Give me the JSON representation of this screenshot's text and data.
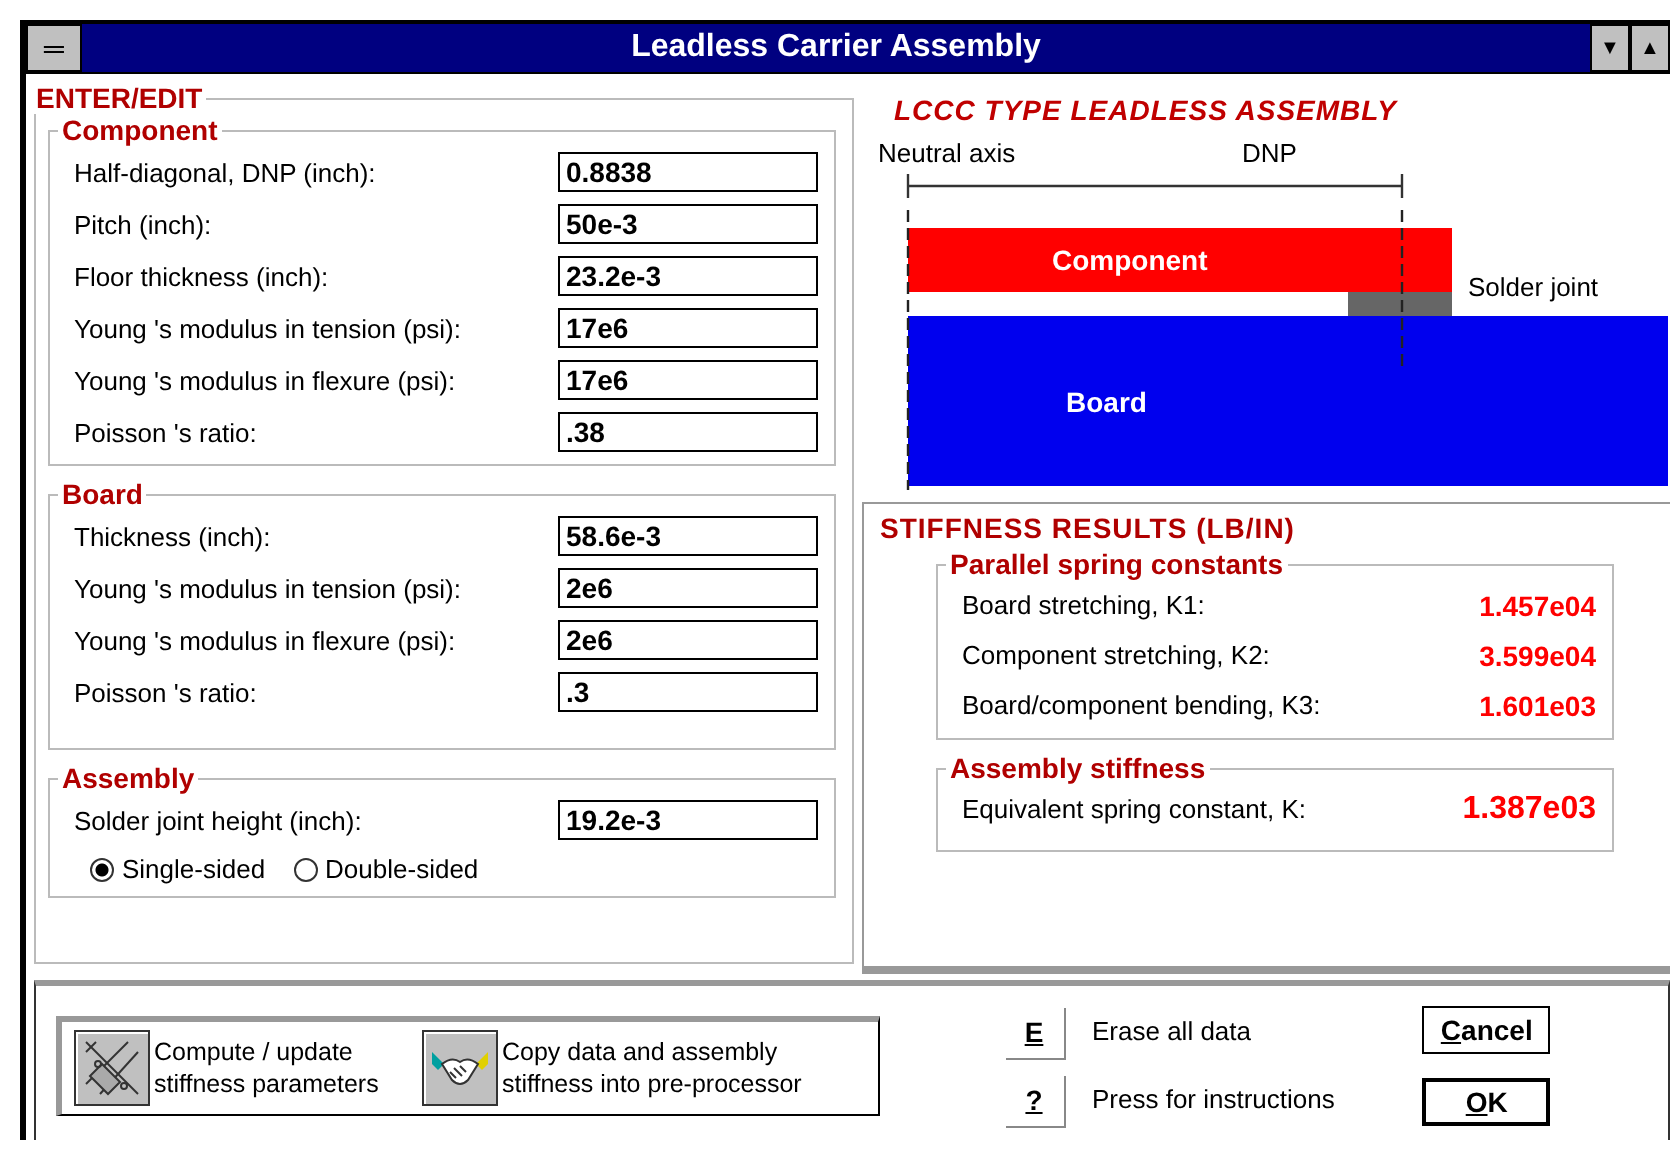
{
  "window": {
    "title": "Leadless Carrier Assembly",
    "system_menu": "═",
    "controls": [
      "▼",
      "▲"
    ]
  },
  "enter_edit": {
    "title": "ENTER/EDIT",
    "groups": [
      {
        "title": "Component",
        "fields": [
          {
            "label": "Half-diagonal, DNP (inch):",
            "value": "0.8838"
          },
          {
            "label": "Pitch (inch):",
            "value": "50e-3"
          },
          {
            "label": "Floor thickness (inch):",
            "value": "23.2e-3"
          },
          {
            "label": "Young 's modulus in tension (psi):",
            "value": "17e6"
          },
          {
            "label": "Young 's modulus in flexure (psi):",
            "value": "17e6"
          },
          {
            "label": "Poisson 's ratio:",
            "value": ".38"
          }
        ]
      },
      {
        "title": "Board",
        "fields": [
          {
            "label": "Thickness (inch):",
            "value": "58.6e-3"
          },
          {
            "label": "Young 's modulus in tension (psi):",
            "value": "2e6"
          },
          {
            "label": "Young 's modulus in flexure (psi):",
            "value": "2e6"
          },
          {
            "label": "Poisson 's ratio:",
            "value": ".3"
          }
        ]
      },
      {
        "title": "Assembly",
        "fields": [
          {
            "label": "Solder joint height (inch):",
            "value": "19.2e-3"
          }
        ],
        "options": [
          {
            "label": "Single-sided",
            "selected": true
          },
          {
            "label": "Double-sided",
            "selected": false
          }
        ]
      }
    ]
  },
  "diagram": {
    "title": "LCCC TYPE LEADLESS ASSEMBLY",
    "neutral_axis": "Neutral axis",
    "dnp": "DNP",
    "component": "Component",
    "solder_joint": "Solder joint",
    "board": "Board"
  },
  "results": {
    "title": "STIFFNESS RESULTS (LB/IN)",
    "groups": [
      {
        "title": "Parallel spring constants",
        "rows": [
          {
            "label": "Board stretching, K1:",
            "value": "1.457e04"
          },
          {
            "label": "Component stretching, K2:",
            "value": "3.599e04"
          },
          {
            "label": "Board/component bending, K3:",
            "value": "1.601e03"
          }
        ]
      },
      {
        "title": "Assembly stiffness",
        "rows": [
          {
            "label": "Equivalent spring constant, K:",
            "value": "1.387e03"
          }
        ]
      }
    ]
  },
  "actions": [
    {
      "kind": "compute",
      "label": "Compute / update stiffness parameters"
    },
    {
      "kind": "copy",
      "label": "Copy data and assembly stiffness into pre-processor"
    }
  ],
  "shortcuts": [
    {
      "key": "E",
      "label": "Erase all data"
    },
    {
      "key": "?",
      "label": "Press for instructions"
    }
  ],
  "buttons": [
    {
      "label": "Cancel",
      "default": false
    },
    {
      "label": "OK",
      "default": true
    }
  ]
}
